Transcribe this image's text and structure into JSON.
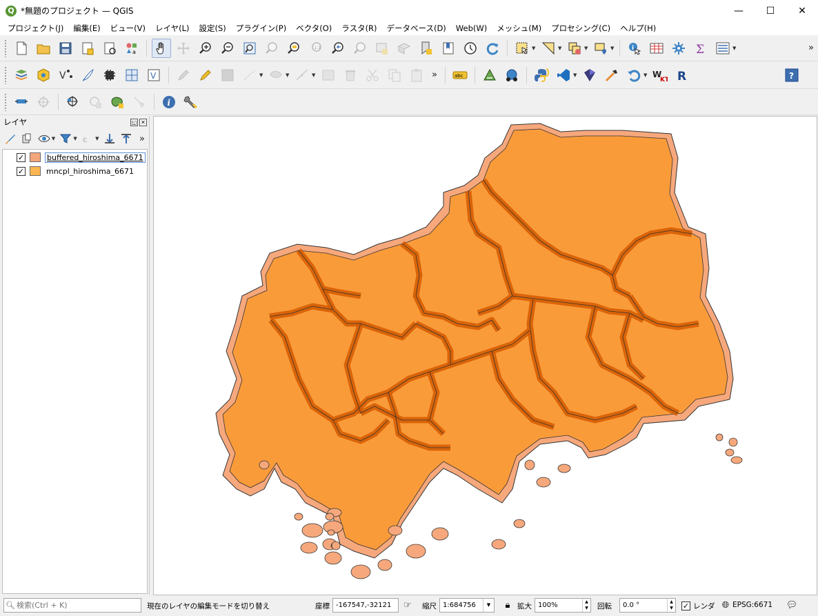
{
  "window": {
    "title": "*無題のプロジェクト — QGIS",
    "minimize_glyph": "—",
    "maximize_glyph": "☐",
    "close_glyph": "✕"
  },
  "menu": [
    "プロジェクト(J)",
    "編集(E)",
    "ビュー(V)",
    "レイヤ(L)",
    "設定(S)",
    "プラグイン(P)",
    "ベクタ(O)",
    "ラスタ(R)",
    "データベース(D)",
    "Web(W)",
    "メッシュ(M)",
    "プロセシング(C)",
    "ヘルプ(H)"
  ],
  "toolbars": {
    "overflow_glyph": "»",
    "row1_icons": [
      "new-project-icon",
      "open-project-icon",
      "save-project-icon",
      "new-print-layout-icon",
      "layout-manager-icon",
      "style-manager-icon",
      "pan-icon",
      "pan-to-selection-icon",
      "zoom-in-icon",
      "zoom-out-icon",
      "zoom-full-icon",
      "zoom-to-selection-icon",
      "zoom-to-layer-icon",
      "zoom-native-icon",
      "zoom-last-icon",
      "zoom-next-icon",
      "new-map-view-icon",
      "new-3d-view-icon",
      "new-bookmark-icon",
      "show-bookmarks-icon",
      "temporal-controller-icon",
      "refresh-icon",
      "select-features-icon",
      "select-by-value-icon",
      "deselect-icon",
      "select-by-location-icon",
      "identify-icon",
      "attribute-table-icon",
      "toolbox-icon",
      "statistics-icon",
      "measure-icon"
    ],
    "row2_icons": [
      "data-source-manager-icon",
      "new-geopackage-layer-icon",
      "new-shapefile-layer-icon",
      "new-spatialite-layer-icon",
      "new-memory-layer-icon",
      "new-virtual-layer-icon",
      "new-mesh-layer-icon",
      "current-edits-icon",
      "toggle-editing-icon",
      "save-edits-icon",
      "digitize-line-icon",
      "add-polygon-icon",
      "vertex-tool-icon",
      "modify-attributes-icon",
      "delete-selected-icon",
      "cut-features-icon",
      "copy-features-icon",
      "paste-features-icon",
      "label-abc-icon",
      "georeferencer-icon",
      "gps-tool-icon",
      "python-console-icon",
      "vscode-icon",
      "layer-geometry-icon",
      "processing-tool-icon",
      "undo-arrow-icon",
      "wkt-icon",
      "r-icon",
      "help-question-icon"
    ],
    "row3_icons": [
      "pin-tool-icon",
      "crosshair-icon",
      "add-point-icon",
      "add-point-locked-icon",
      "add-green-shape-icon",
      "snapping-tool-icon",
      "info-icon",
      "wrench-icon"
    ]
  },
  "layers_panel": {
    "title": "レイヤ",
    "float_glyph": "◱",
    "close_glyph": "✕",
    "overflow_glyph": "»",
    "toolbar_icons": [
      "style-panel-icon",
      "add-group-icon",
      "visibility-icon",
      "filter-icon",
      "expression-filter-icon",
      "expand-all-icon",
      "collapse-all-icon"
    ],
    "layers": [
      {
        "name": "buffered_hiroshima_6671",
        "checked": true,
        "color": "#f4a67b",
        "selected": true
      },
      {
        "name": "mncpl_hiroshima_6671",
        "checked": true,
        "color": "#fbb651",
        "selected": false
      }
    ]
  },
  "map": {
    "buffer_fill": "#f6a87c",
    "municipality_fill": "#fa9b3a",
    "boundary_color": "#d45a00",
    "outline_color": "#333333"
  },
  "statusbar": {
    "search_placeholder": "検索(Ctrl + K)",
    "message": "現在のレイヤの編集モードを切り替え",
    "coord_label": "座標",
    "coord_value": "-167547,-32121",
    "scale_label": "縮尺",
    "scale_value": "1:684756",
    "magnifier_label": "拡大",
    "magnifier_value": "100%",
    "rotation_label": "回転",
    "rotation_value": "0.0 °",
    "render_label": "レンダ",
    "render_checked": true,
    "crs_label": "EPSG:6671"
  }
}
